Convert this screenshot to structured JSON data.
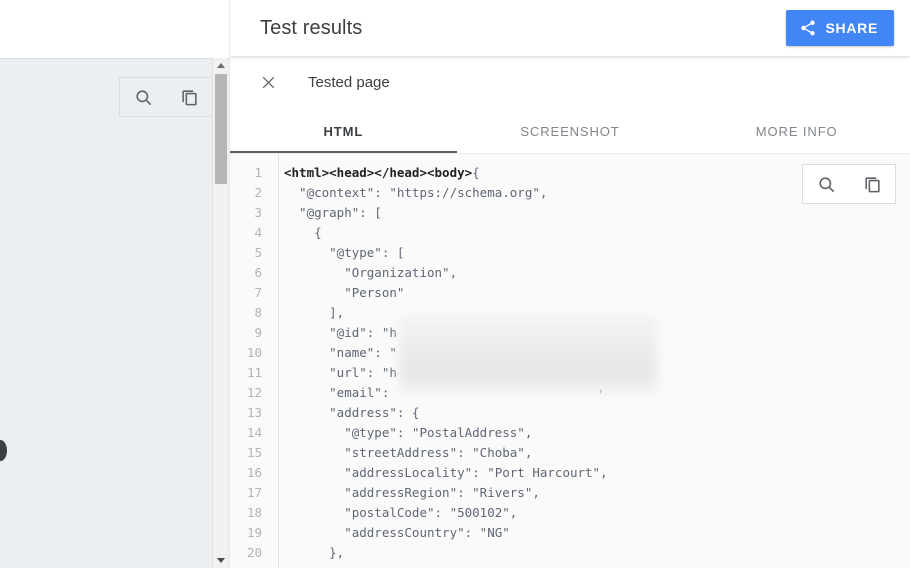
{
  "background": {
    "toolbar": {
      "search_icon": "search-icon",
      "copy_icon": "copy-icon"
    },
    "scrollbar": {
      "up_arrow": "scroll-up-arrow-icon",
      "down_arrow": "scroll-down-arrow-icon"
    }
  },
  "panel": {
    "header": {
      "title": "Test results",
      "share_label": "SHARE",
      "share_icon": "share-icon",
      "share_color": "#4285f4"
    },
    "tested_page": {
      "close_icon": "close-icon",
      "label": "Tested page"
    },
    "tabs": [
      {
        "label": "HTML",
        "active": true
      },
      {
        "label": "SCREENSHOT",
        "active": false
      },
      {
        "label": "MORE INFO",
        "active": false
      }
    ],
    "code_tools": {
      "search_icon": "search-icon",
      "copy_icon": "copy-icon"
    },
    "code": {
      "lines": [
        {
          "n": "1",
          "text": "<html><head></head><body>",
          "bold": true,
          "tail": "{"
        },
        {
          "n": "2",
          "text": "  \"@context\": \"https://schema.org\","
        },
        {
          "n": "3",
          "text": "  \"@graph\": ["
        },
        {
          "n": "4",
          "text": "    {"
        },
        {
          "n": "5",
          "text": "      \"@type\": ["
        },
        {
          "n": "6",
          "text": "        \"Organization\","
        },
        {
          "n": "7",
          "text": "        \"Person\""
        },
        {
          "n": "8",
          "text": "      ],"
        },
        {
          "n": "9",
          "text": "      \"@id\": \"h"
        },
        {
          "n": "10",
          "text": "      \"name\": \""
        },
        {
          "n": "11",
          "text": "      \"url\": \"h"
        },
        {
          "n": "12",
          "text": "      \"email\": "
        },
        {
          "n": "13",
          "text": "      \"address\": {"
        },
        {
          "n": "14",
          "text": "        \"@type\": \"PostalAddress\","
        },
        {
          "n": "15",
          "text": "        \"streetAddress\": \"Choba\","
        },
        {
          "n": "16",
          "text": "        \"addressLocality\": \"Port Harcourt\","
        },
        {
          "n": "17",
          "text": "        \"addressRegion\": \"Rivers\","
        },
        {
          "n": "18",
          "text": "        \"postalCode\": \"500102\","
        },
        {
          "n": "19",
          "text": "        \"addressCountry\": \"NG\""
        },
        {
          "n": "20",
          "text": "      },"
        }
      ],
      "redacted_comma": ","
    }
  }
}
